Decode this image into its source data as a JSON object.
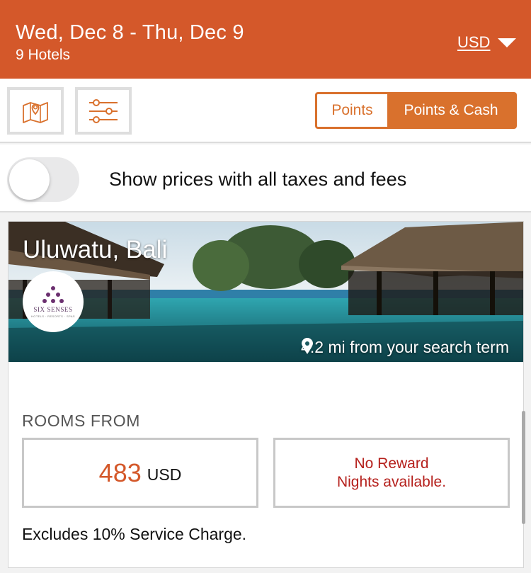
{
  "header": {
    "dates": "Wed, Dec 8 - Thu, Dec 9",
    "hotel_count": "9 Hotels",
    "currency": "USD"
  },
  "toolbar": {
    "map_icon": "map-pin-icon",
    "filter_icon": "sliders-icon",
    "segments": [
      "Points",
      "Points & Cash"
    ],
    "active_segment": "Points"
  },
  "tax_toggle": {
    "label": "Show prices with all taxes and fees",
    "enabled": false
  },
  "hotel": {
    "location": "Uluwatu, Bali",
    "logo_text": "SIX SENSES",
    "logo_subtext": "HOTELS · RESORTS · SPAS",
    "distance": "4.2 mi from your search term",
    "rooms_from_label": "ROOMS FROM",
    "price_amount": "483",
    "price_currency": "USD",
    "reward_line1": "No Reward",
    "reward_line2": "Nights available.",
    "note": "Excludes 10% Service Charge."
  },
  "colors": {
    "brand": "#d4582a",
    "segment_accent": "#d9712d",
    "reward_text": "#b5201c"
  }
}
